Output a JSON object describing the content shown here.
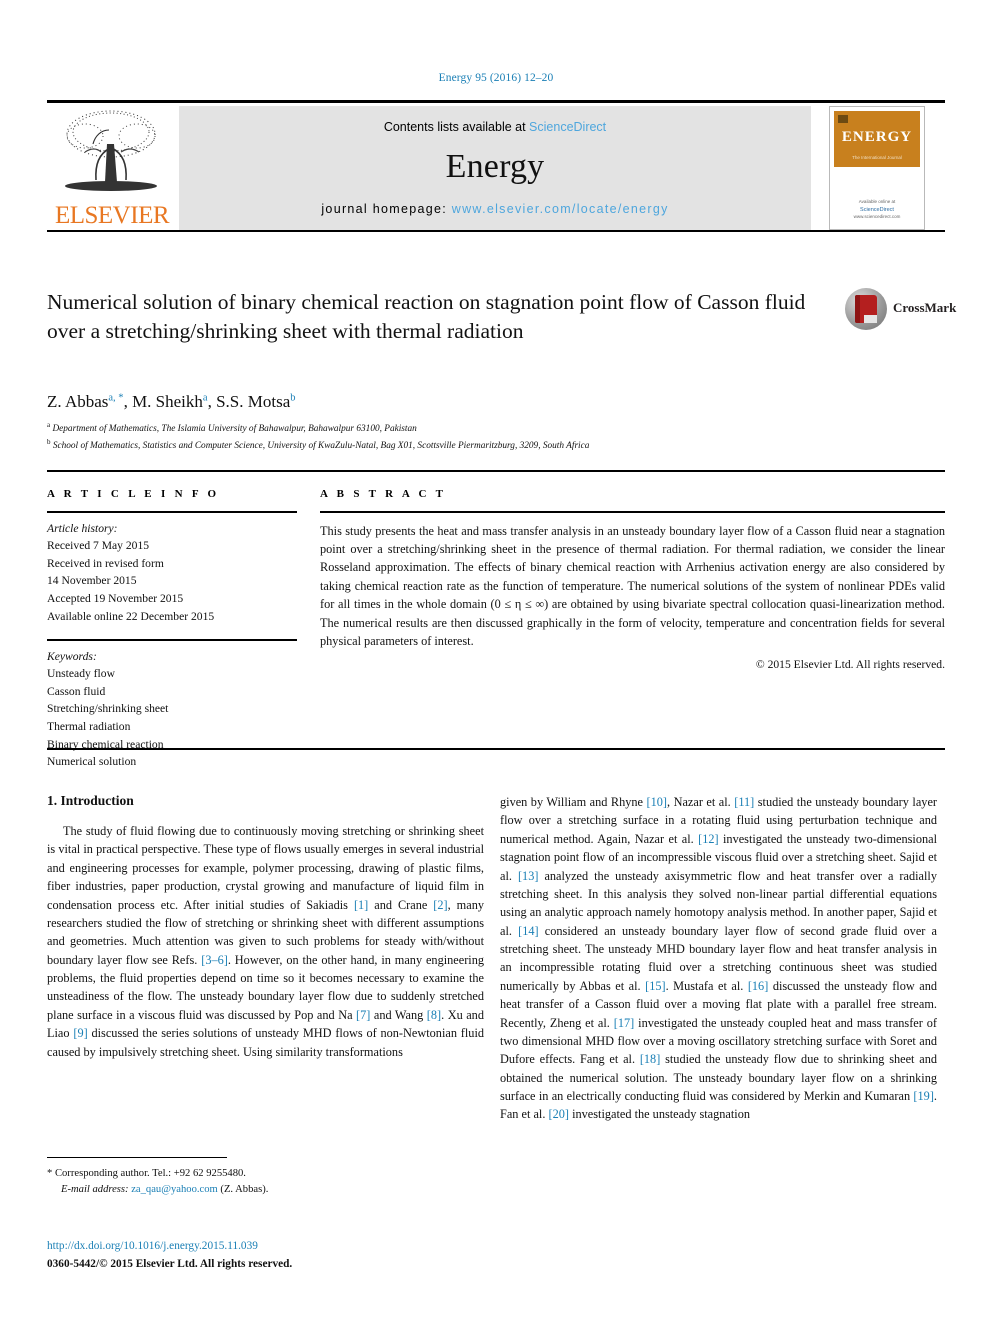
{
  "running_head": "Energy 95 (2016) 12–20",
  "masthead": {
    "contents_prefix": "Contents lists available at ",
    "sciencedirect": "ScienceDirect",
    "journal_name": "Energy",
    "homepage_prefix": "journal homepage: ",
    "homepage_url": "www.elsevier.com/locate/energy",
    "publisher": "ELSEVIER",
    "cover_title": "ENERGY",
    "cover_subtitle": "The International Journal",
    "cover_footer": "Available online at",
    "cover_footer_brand": "ScienceDirect",
    "cover_footer_sub": "www.sciencedirect.com",
    "accent_blue": "#4ea6dd",
    "elsevier_orange": "#E87722",
    "cover_orange": "#C8801E"
  },
  "article": {
    "title": "Numerical solution of binary chemical reaction on stagnation point flow of Casson fluid over a stretching/shrinking sheet with thermal radiation",
    "crossmark_label": "CrossMark",
    "authors": [
      {
        "name": "Z. Abbas",
        "marks": "a, *"
      },
      {
        "name": "M. Sheikh",
        "marks": "a"
      },
      {
        "name": "S.S. Motsa",
        "marks": "b"
      }
    ],
    "affiliations": [
      {
        "mark": "a",
        "text": "Department of Mathematics, The Islamia University of Bahawalpur, Bahawalpur 63100, Pakistan"
      },
      {
        "mark": "b",
        "text": "School of Mathematics, Statistics and Computer Science, University of KwaZulu-Natal, Bag X01, Scottsville Piermaritzburg, 3209, South Africa"
      }
    ]
  },
  "article_info": {
    "heading": "A R T I C L E   I N F O",
    "history_label": "Article history:",
    "history": [
      "Received 7 May 2015",
      "Received in revised form",
      "14 November 2015",
      "Accepted 19 November 2015",
      "Available online 22 December 2015"
    ],
    "keywords_label": "Keywords:",
    "keywords": [
      "Unsteady flow",
      "Casson fluid",
      "Stretching/shrinking sheet",
      "Thermal radiation",
      "Binary chemical reaction",
      "Numerical solution"
    ]
  },
  "abstract": {
    "heading": "A B S T R A C T",
    "text": "This study presents the heat and mass transfer analysis in an unsteady boundary layer flow of a Casson fluid near a stagnation point over a stretching/shrinking sheet in the presence of thermal radiation. For thermal radiation, we consider the linear Rosseland approximation. The effects of binary chemical reaction with Arrhenius activation energy are also considered by taking chemical reaction rate as the function of temperature. The numerical solutions of the system of nonlinear PDEs valid for all times in the whole domain (0 ≤ η ≤ ∞) are obtained by using bivariate spectral collocation quasi-linearization method. The numerical results are then discussed graphically in the form of velocity, temperature and concentration fields for several physical parameters of interest.",
    "copyright": "© 2015 Elsevier Ltd. All rights reserved."
  },
  "introduction": {
    "heading": "1. Introduction",
    "left_paragraph_html": "The study of fluid flowing due to continuously moving stretching or shrinking sheet is vital in practical perspective. These type of flows usually emerges in several industrial and engineering processes for example, polymer processing, drawing of plastic films, fiber industries, paper production, crystal growing and manufacture of liquid film in condensation process etc. After initial studies of Sakiadis [1] and Crane [2], many researchers studied the flow of stretching or shrinking sheet with different assumptions and geometries. Much attention was given to such problems for steady with/without boundary layer flow see Refs. [3–6]. However, on the other hand, in many engineering problems, the fluid properties depend on time so it becomes necessary to examine the unsteadiness of the flow. The unsteady boundary layer flow due to suddenly stretched plane surface in a viscous fluid was discussed by Pop and Na [7] and Wang [8]. Xu and Liao [9] discussed the series solutions of unsteady MHD flows of non-Newtonian fluid caused by impulsively stretching sheet. Using similarity transformations",
    "right_paragraph_html": "given by William and Rhyne [10], Nazar et al. [11] studied the unsteady boundary layer flow over a stretching surface in a rotating fluid using perturbation technique and numerical method. Again, Nazar et al. [12] investigated the unsteady two-dimensional stagnation point flow of an incompressible viscous fluid over a stretching sheet. Sajid et al. [13] analyzed the unsteady axisymmetric flow and heat transfer over a radially stretching sheet. In this analysis they solved non-linear partial differential equations using an analytic approach namely homotopy analysis method. In another paper, Sajid et al. [14] considered an unsteady boundary layer flow of second grade fluid over a stretching sheet. The unsteady MHD boundary layer flow and heat transfer analysis in an incompressible rotating fluid over a stretching continuous sheet was studied numerically by Abbas et al. [15]. Mustafa et al. [16] discussed the unsteady flow and heat transfer of a Casson fluid over a moving flat plate with a parallel free stream. Recently, Zheng et al. [17] investigated the unsteady coupled heat and mass transfer of two dimensional MHD flow over a moving oscillatory stretching surface with Soret and Dufore effects. Fang et al. [18] studied the unsteady flow due to shrinking sheet and obtained the numerical solution. The unsteady boundary layer flow on a shrinking surface in an electrically conducting fluid was considered by Merkin and Kumaran [19]. Fan et al. [20] investigated the unsteady stagnation"
  },
  "footnote": {
    "corresponding": "* Corresponding author. Tel.: +92 62 9255480.",
    "email_label": "E-mail address:",
    "email": "za_qau@yahoo.com",
    "email_owner": "(Z. Abbas)."
  },
  "footer": {
    "doi": "http://dx.doi.org/10.1016/j.energy.2015.11.039",
    "issn_line": "0360-5442/© 2015 Elsevier Ltd. All rights reserved."
  }
}
